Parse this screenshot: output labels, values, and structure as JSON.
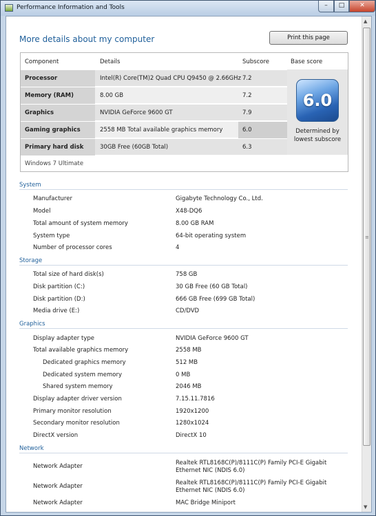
{
  "window": {
    "title": "Performance Information and Tools",
    "minimize_glyph": "–",
    "maximize_glyph": "□",
    "close_glyph": "✕"
  },
  "page": {
    "heading": "More details about my computer",
    "print_label": "Print this page"
  },
  "score_table": {
    "headers": [
      "Component",
      "Details",
      "Subscore",
      "Base score"
    ],
    "rows": [
      {
        "category": "Processor",
        "details": "Intel(R) Core(TM)2 Quad CPU Q9450 @ 2.66GHz",
        "subscore": "7.2"
      },
      {
        "category": "Memory (RAM)",
        "details": "8.00 GB",
        "subscore": "7.2"
      },
      {
        "category": "Graphics",
        "details": "NVIDIA GeForce 9600 GT",
        "subscore": "7.9"
      },
      {
        "category": "Gaming graphics",
        "details": "2558 MB Total available graphics memory",
        "subscore": "6.0"
      },
      {
        "category": "Primary hard disk",
        "details": "30GB Free (60GB Total)",
        "subscore": "6.3"
      }
    ],
    "base_score": "6.0",
    "base_caption": "Determined by lowest subscore",
    "os": "Windows 7 Ultimate"
  },
  "sections": {
    "system": {
      "title": "System",
      "rows": [
        {
          "label": "Manufacturer",
          "value": "Gigabyte Technology Co., Ltd."
        },
        {
          "label": "Model",
          "value": "X48-DQ6"
        },
        {
          "label": "Total amount of system memory",
          "value": "8.00 GB RAM"
        },
        {
          "label": "System type",
          "value": "64-bit operating system"
        },
        {
          "label": "Number of processor cores",
          "value": "4"
        }
      ]
    },
    "storage": {
      "title": "Storage",
      "rows": [
        {
          "label": "Total size of hard disk(s)",
          "value": "758 GB"
        },
        {
          "label": "Disk partition (C:)",
          "value": "30 GB Free (60 GB Total)"
        },
        {
          "label": "Disk partition (D:)",
          "value": "666 GB Free (699 GB Total)"
        },
        {
          "label": "Media drive (E:)",
          "value": "CD/DVD"
        }
      ]
    },
    "graphics": {
      "title": "Graphics",
      "rows": [
        {
          "label": "Display adapter type",
          "value": "NVIDIA GeForce 9600 GT"
        },
        {
          "label": "Total available graphics memory",
          "value": "2558 MB"
        },
        {
          "label": "Dedicated graphics memory",
          "value": "512 MB"
        },
        {
          "label": "Dedicated system memory",
          "value": "0 MB"
        },
        {
          "label": "Shared system memory",
          "value": "2046 MB"
        },
        {
          "label": "Display adapter driver version",
          "value": "7.15.11.7816"
        },
        {
          "label": "Primary monitor resolution",
          "value": "1920x1200"
        },
        {
          "label": "Secondary monitor resolution",
          "value": "1280x1024"
        },
        {
          "label": "DirectX version",
          "value": "DirectX 10"
        }
      ]
    },
    "network": {
      "title": "Network",
      "rows": [
        {
          "label": "Network Adapter",
          "value": "Realtek RTL8168C(P)/8111C(P) Family PCI-E Gigabit Ethernet NIC (NDIS 6.0)"
        },
        {
          "label": "Network Adapter",
          "value": "Realtek RTL8168C(P)/8111C(P) Family PCI-E Gigabit Ethernet NIC (NDIS 6.0)"
        },
        {
          "label": "Network Adapter",
          "value": "MAC Bridge Miniport"
        }
      ]
    }
  },
  "colors": {
    "accent": "#1f5f9a",
    "base_badge": "#2963b4"
  }
}
